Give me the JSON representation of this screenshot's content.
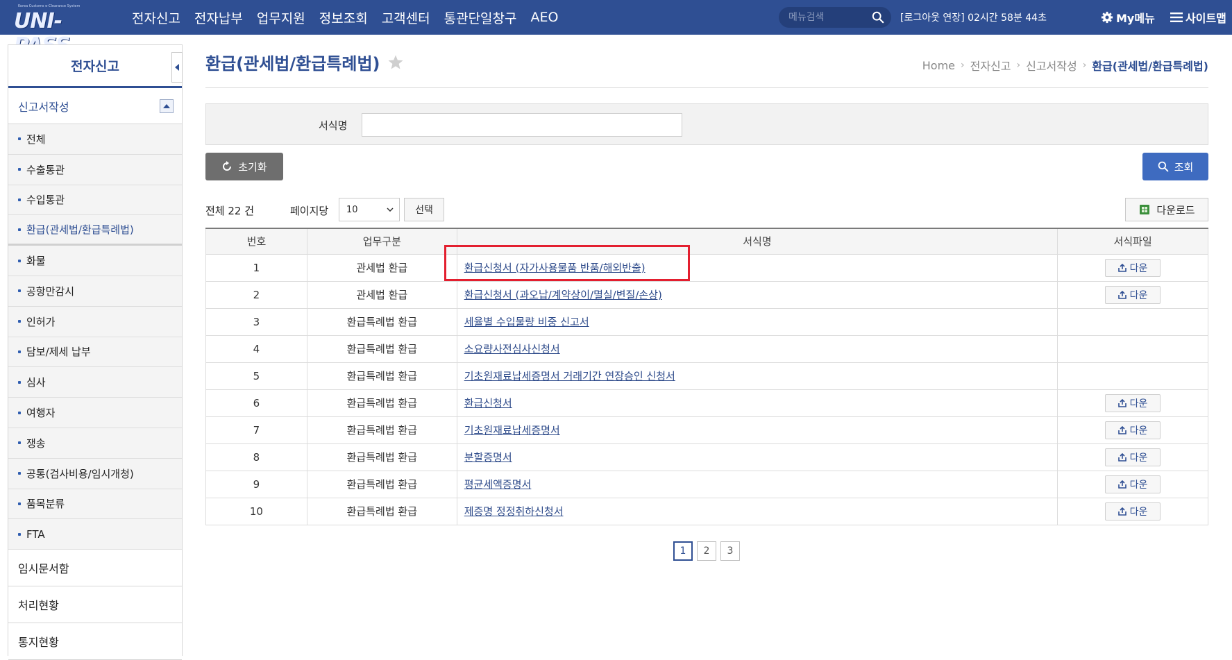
{
  "header": {
    "logo_sub": "Korea Customs e-Clearance System",
    "logo_main": "UNI-PASS",
    "nav": [
      "전자신고",
      "전자납부",
      "업무지원",
      "정보조회",
      "고객센터",
      "통관단일창구",
      "AEO"
    ],
    "search_placeholder": "메뉴검색",
    "session_text": "[로그아웃 연장] 02시간 58분 44초",
    "my_menu": "My메뉴",
    "sitemap": "사이트맵"
  },
  "sidebar": {
    "title": "전자신고",
    "section": "신고서작성",
    "items": [
      {
        "label": "전체"
      },
      {
        "label": "수출통관"
      },
      {
        "label": "수입통관"
      },
      {
        "label": "환급(관세법/환급특례법)"
      },
      {
        "label": "화물"
      },
      {
        "label": "공항만감시"
      },
      {
        "label": "인허가"
      },
      {
        "label": "담보/제세 납부"
      },
      {
        "label": "심사"
      },
      {
        "label": "여행자"
      },
      {
        "label": "쟁송"
      },
      {
        "label": "공통(검사비용/임시개청)"
      },
      {
        "label": "품목분류"
      },
      {
        "label": "FTA"
      }
    ],
    "links": [
      "임시문서함",
      "처리현황",
      "통지현황"
    ]
  },
  "page": {
    "title": "환급(관세법/환급특례법)",
    "breadcrumb": [
      "Home",
      "전자신고",
      "신고서작성",
      "환급(관세법/환급특례법)"
    ]
  },
  "search": {
    "label": "서식명",
    "value": "",
    "reset_label": "초기화",
    "search_label": "조회"
  },
  "list": {
    "total_prefix": "전체",
    "total_count": "22",
    "total_suffix": "건",
    "per_page_label": "페이지당",
    "per_page_value": "10",
    "select_label": "선택",
    "download_label": "다운로드",
    "columns": [
      "번호",
      "업무구분",
      "서식명",
      "서식파일"
    ],
    "rows": [
      {
        "no": "1",
        "category": "관세법 환급",
        "form": "환급신청서 (자가사용물품 반품/해외반출)",
        "file": "다운"
      },
      {
        "no": "2",
        "category": "관세법 환급",
        "form": "환급신청서 (과오납/계약상이/멸실/변질/손상)",
        "file": "다운"
      },
      {
        "no": "3",
        "category": "환급특례법 환급",
        "form": "세율별 수입물량 비중 신고서",
        "file": ""
      },
      {
        "no": "4",
        "category": "환급특례법 환급",
        "form": "소요량사전심사신청서",
        "file": ""
      },
      {
        "no": "5",
        "category": "환급특례법 환급",
        "form": "기초원재료납세증명서 거래기간 연장승인 신청서",
        "file": ""
      },
      {
        "no": "6",
        "category": "환급특례법 환급",
        "form": "환급신청서",
        "file": "다운"
      },
      {
        "no": "7",
        "category": "환급특례법 환급",
        "form": "기초원재료납세증명서",
        "file": "다운"
      },
      {
        "no": "8",
        "category": "환급특례법 환급",
        "form": "분할증명서",
        "file": "다운"
      },
      {
        "no": "9",
        "category": "환급특례법 환급",
        "form": "평균세액증명서",
        "file": "다운"
      },
      {
        "no": "10",
        "category": "환급특례법 환급",
        "form": "제증명 정정취하신청서",
        "file": "다운"
      }
    ]
  },
  "pagination": {
    "pages": [
      "1",
      "2",
      "3"
    ],
    "current": "1"
  },
  "colors": {
    "brand": "#2f4f93",
    "search_button": "#3e6bc0",
    "highlight": "#e31f2f"
  }
}
